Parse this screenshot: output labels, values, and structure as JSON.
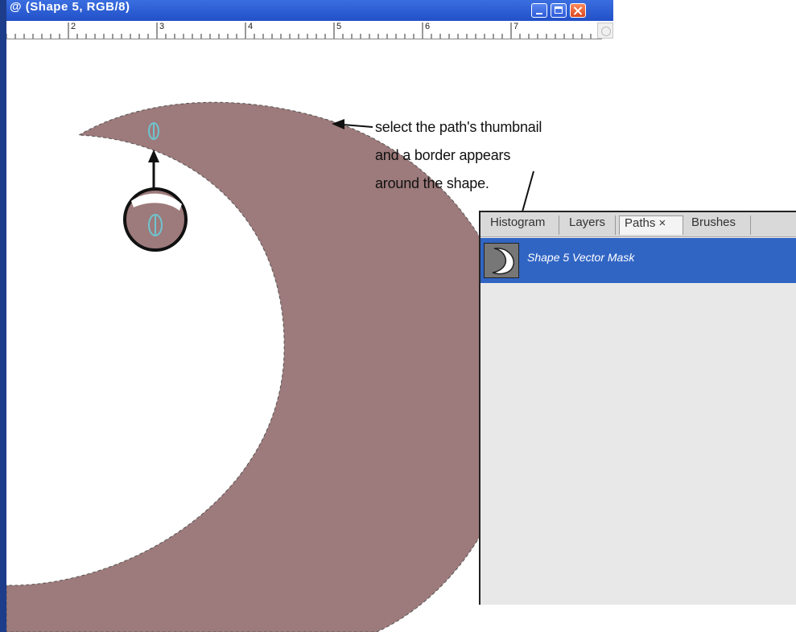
{
  "window": {
    "title": "@ (Shape 5, RGB/8)"
  },
  "ruler": {
    "numbers": [
      "2",
      "3",
      "4",
      "5",
      "6",
      "7"
    ]
  },
  "annotation": {
    "lines": [
      "select the path's thumbnail",
      "and a border appears",
      "around the shape."
    ]
  },
  "panel": {
    "tabs": [
      {
        "label": "Histogram"
      },
      {
        "label": "Layers"
      },
      {
        "label": "Paths ×"
      },
      {
        "label": "Brushes"
      }
    ],
    "active_tab": "Paths",
    "path_row": {
      "label": "Shape 5 Vector Mask",
      "thumbnail_icon": "crescent-moon-icon"
    }
  },
  "colors": {
    "shape_fill": "#9d7a7b",
    "selection_blue": "#3165c4",
    "title_blue": "#2250c8",
    "cursor_cyan": "#6fc4cf"
  },
  "icons": {
    "cursor": "text-ibeam-cursor-icon",
    "window_buttons": [
      "minimize-icon",
      "maximize-icon",
      "close-icon"
    ]
  }
}
